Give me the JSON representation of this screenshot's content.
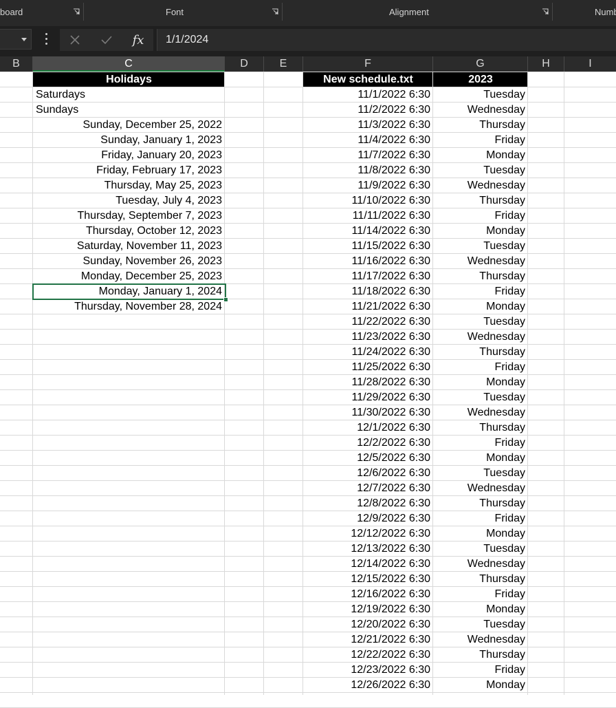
{
  "ribbon": {
    "groups": [
      {
        "label": "board"
      },
      {
        "label": "Font"
      },
      {
        "label": "Alignment"
      },
      {
        "label": "Numb"
      }
    ]
  },
  "formula_bar": {
    "name_box": "",
    "cancel_icon": "close-icon",
    "enter_icon": "check-icon",
    "function_label": "fx",
    "value": "1/1/2024"
  },
  "columns": [
    "B",
    "C",
    "D",
    "E",
    "F",
    "G",
    "H",
    "I"
  ],
  "selected_column": "C",
  "headers": {
    "holidays": "Holidays",
    "schedule": "New schedule.txt",
    "year": "2023"
  },
  "holidays": [
    "Saturdays",
    "Sundays",
    "Sunday, December 25, 2022",
    "Sunday, January 1, 2023",
    "Friday, January 20, 2023",
    "Friday, February 17, 2023",
    "Thursday, May 25, 2023",
    "Tuesday, July 4, 2023",
    "Thursday, September 7, 2023",
    "Thursday, October 12, 2023",
    "Saturday, November 11, 2023",
    "Sunday, November 26, 2023",
    "Monday, December 25, 2023",
    "Monday, January 1, 2024",
    "Thursday, November 28, 2024"
  ],
  "active_holiday_index": 13,
  "schedule": [
    [
      "11/1/2022 6:30",
      "Tuesday"
    ],
    [
      "11/2/2022 6:30",
      "Wednesday"
    ],
    [
      "11/3/2022 6:30",
      "Thursday"
    ],
    [
      "11/4/2022 6:30",
      "Friday"
    ],
    [
      "11/7/2022 6:30",
      "Monday"
    ],
    [
      "11/8/2022 6:30",
      "Tuesday"
    ],
    [
      "11/9/2022 6:30",
      "Wednesday"
    ],
    [
      "11/10/2022 6:30",
      "Thursday"
    ],
    [
      "11/11/2022 6:30",
      "Friday"
    ],
    [
      "11/14/2022 6:30",
      "Monday"
    ],
    [
      "11/15/2022 6:30",
      "Tuesday"
    ],
    [
      "11/16/2022 6:30",
      "Wednesday"
    ],
    [
      "11/17/2022 6:30",
      "Thursday"
    ],
    [
      "11/18/2022 6:30",
      "Friday"
    ],
    [
      "11/21/2022 6:30",
      "Monday"
    ],
    [
      "11/22/2022 6:30",
      "Tuesday"
    ],
    [
      "11/23/2022 6:30",
      "Wednesday"
    ],
    [
      "11/24/2022 6:30",
      "Thursday"
    ],
    [
      "11/25/2022 6:30",
      "Friday"
    ],
    [
      "11/28/2022 6:30",
      "Monday"
    ],
    [
      "11/29/2022 6:30",
      "Tuesday"
    ],
    [
      "11/30/2022 6:30",
      "Wednesday"
    ],
    [
      "12/1/2022 6:30",
      "Thursday"
    ],
    [
      "12/2/2022 6:30",
      "Friday"
    ],
    [
      "12/5/2022 6:30",
      "Monday"
    ],
    [
      "12/6/2022 6:30",
      "Tuesday"
    ],
    [
      "12/7/2022 6:30",
      "Wednesday"
    ],
    [
      "12/8/2022 6:30",
      "Thursday"
    ],
    [
      "12/9/2022 6:30",
      "Friday"
    ],
    [
      "12/12/2022 6:30",
      "Monday"
    ],
    [
      "12/13/2022 6:30",
      "Tuesday"
    ],
    [
      "12/14/2022 6:30",
      "Wednesday"
    ],
    [
      "12/15/2022 6:30",
      "Thursday"
    ],
    [
      "12/16/2022 6:30",
      "Friday"
    ],
    [
      "12/19/2022 6:30",
      "Monday"
    ],
    [
      "12/20/2022 6:30",
      "Tuesday"
    ],
    [
      "12/21/2022 6:30",
      "Wednesday"
    ],
    [
      "12/22/2022 6:30",
      "Thursday"
    ],
    [
      "12/23/2022 6:30",
      "Friday"
    ],
    [
      "12/26/2022 6:30",
      "Monday"
    ]
  ],
  "colors": {
    "ribbon_bg": "#292929",
    "header_fill": "#000000",
    "selection_border": "#217346",
    "gridline": "#d9d9d9"
  }
}
